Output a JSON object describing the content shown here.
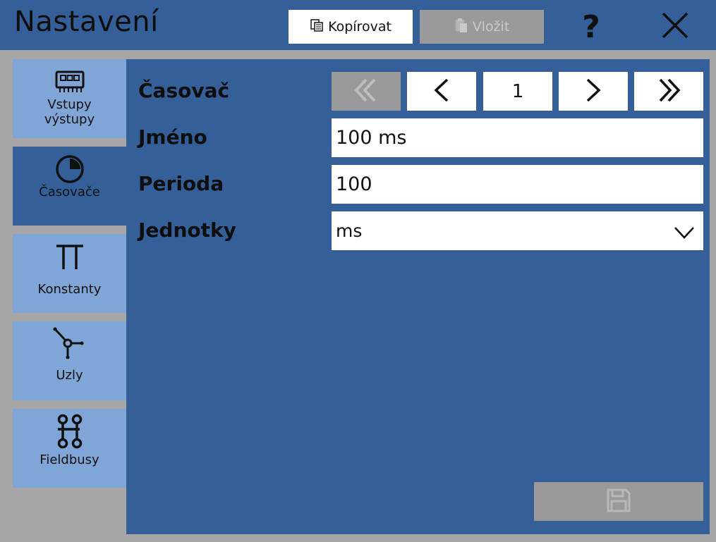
{
  "window": {
    "title": "Nastavení",
    "copy_label": "Kopírovat",
    "paste_label": "Vložit",
    "help_label": "?"
  },
  "sidebar": {
    "items": [
      {
        "label": "Vstupy\nvýstupy",
        "icon": "io-module-icon",
        "active": false
      },
      {
        "label": "Časovače",
        "icon": "timer-icon",
        "active": true
      },
      {
        "label": "Konstanty",
        "icon": "pi-constant-icon",
        "active": false
      },
      {
        "label": "Uzly",
        "icon": "node-icon",
        "active": false
      },
      {
        "label": "Fieldbusy",
        "icon": "fieldbus-icon",
        "active": false
      }
    ]
  },
  "form": {
    "timer_label": "Časovač",
    "page_number": "1",
    "name_label": "Jméno",
    "name_value": "100 ms",
    "period_label": "Perioda",
    "period_value": "100",
    "units_label": "Jednotky",
    "units_value": "ms"
  },
  "colors": {
    "accent": "#345f98",
    "sidebar": "#7fa6d6",
    "disabled": "#999999",
    "background": "#a6a6a6"
  }
}
